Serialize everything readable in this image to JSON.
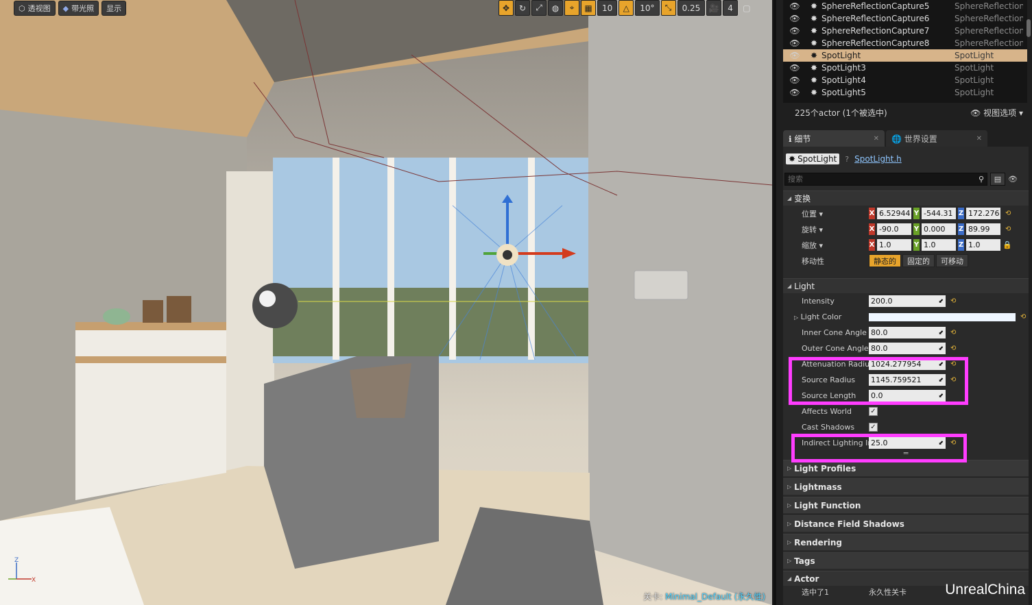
{
  "viewport": {
    "toolbar_left": [
      {
        "label": "透视图",
        "icon": "perspective-icon"
      },
      {
        "label": "带光照",
        "icon": "lit-icon"
      },
      {
        "label": "显示",
        "icon": ""
      }
    ],
    "toolbar_right": {
      "grid_snap": "10",
      "rotate_snap": "10°",
      "scale_snap": "0.25",
      "camera_speed": "4"
    },
    "level_label": "关卡:",
    "level_name": "Minimal_Default (永久性)"
  },
  "outliner": {
    "rows": [
      {
        "name": "SphereReflectionCapture5",
        "type": "SphereReflectionC",
        "selected": false
      },
      {
        "name": "SphereReflectionCapture6",
        "type": "SphereReflectionC",
        "selected": false
      },
      {
        "name": "SphereReflectionCapture7",
        "type": "SphereReflectionC",
        "selected": false
      },
      {
        "name": "SphereReflectionCapture8",
        "type": "SphereReflectionC",
        "selected": false
      },
      {
        "name": "SpotLight",
        "type": "SpotLight",
        "selected": true
      },
      {
        "name": "SpotLight3",
        "type": "SpotLight",
        "selected": false
      },
      {
        "name": "SpotLight4",
        "type": "SpotLight",
        "selected": false
      },
      {
        "name": "SpotLight5",
        "type": "SpotLight",
        "selected": false
      }
    ],
    "count_text": "225个actor (1个被选中)",
    "view_options": "视图选项"
  },
  "tabs": [
    {
      "label": "细节",
      "active": true
    },
    {
      "label": "世界设置",
      "active": false
    }
  ],
  "details": {
    "actor_name": "SpotLight",
    "header_file": "SpotLight.h",
    "search_placeholder": "搜索",
    "transform": {
      "title": "变换",
      "location_label": "位置",
      "location": [
        "6.52944",
        "-544.31",
        "172.276"
      ],
      "rotation_label": "旋转",
      "rotation": [
        "-90.0",
        "0.000",
        "89.99"
      ],
      "scale_label": "缩放",
      "scale": [
        "1.0",
        "1.0",
        "1.0"
      ],
      "mobility_label": "移动性",
      "mobility": [
        "静态的",
        "固定的",
        "可移动"
      ]
    },
    "light": {
      "title": "Light",
      "intensity_label": "Intensity",
      "intensity": "200.0",
      "light_color_label": "Light Color",
      "inner_cone_label": "Inner Cone Angle",
      "inner_cone": "80.0",
      "outer_cone_label": "Outer Cone Angle",
      "outer_cone": "80.0",
      "atten_label": "Attenuation Radius",
      "atten": "1024.277954",
      "source_radius_label": "Source Radius",
      "source_radius": "1145.759521",
      "source_length_label": "Source Length",
      "source_length": "0.0",
      "affects_world_label": "Affects World",
      "cast_shadows_label": "Cast Shadows",
      "indirect_label": "Indirect Lighting Int",
      "indirect": "25.0"
    },
    "categories": [
      "Light Profiles",
      "Lightmass",
      "Light Function",
      "Distance Field Shadows",
      "Rendering",
      "Tags"
    ],
    "actor_cat": "Actor",
    "actor_row_label": "选中了1",
    "actor_row_value": "永久性关卡"
  },
  "watermark": "UnrealChina",
  "colors": {
    "selection": "#d7b48a",
    "highlight": "#ff3dff",
    "accent": "#e8a42b"
  }
}
